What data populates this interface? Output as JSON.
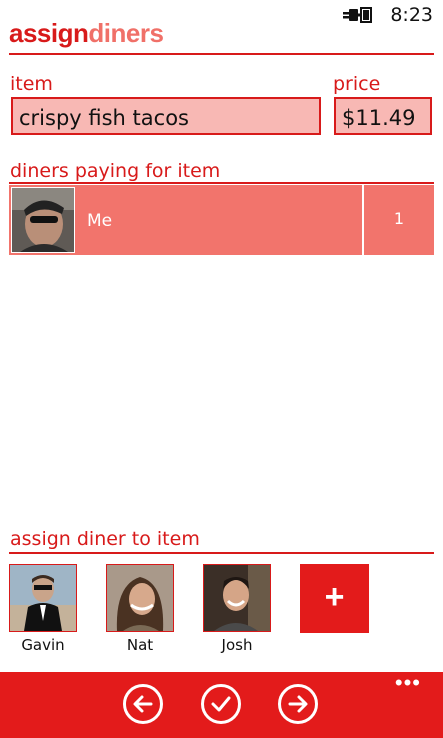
{
  "status_bar": {
    "time": "8:23",
    "icon": "power-plug-icon"
  },
  "title": {
    "part1": "assign",
    "part2": "diners"
  },
  "item": {
    "label": "item",
    "value": "crispy fish tacos"
  },
  "price": {
    "label": "price",
    "value": "$11.49"
  },
  "paying_section": {
    "heading": "diners paying for item",
    "diners": [
      {
        "name": "Me",
        "count": "1"
      }
    ]
  },
  "assign_section": {
    "heading": "assign diner to item",
    "diners": [
      {
        "name": "Gavin"
      },
      {
        "name": "Nat"
      },
      {
        "name": "Josh"
      }
    ],
    "add_label": "+"
  },
  "app_bar": {
    "buttons": [
      "back-arrow-icon",
      "checkmark-icon",
      "forward-arrow-icon"
    ],
    "more": "•••"
  },
  "colors": {
    "accent": "#d81a1a",
    "accent_light": "#f07068",
    "row_bg": "#f2746c",
    "field_bg": "#f8b8b4",
    "app_bar": "#e31b1b"
  }
}
